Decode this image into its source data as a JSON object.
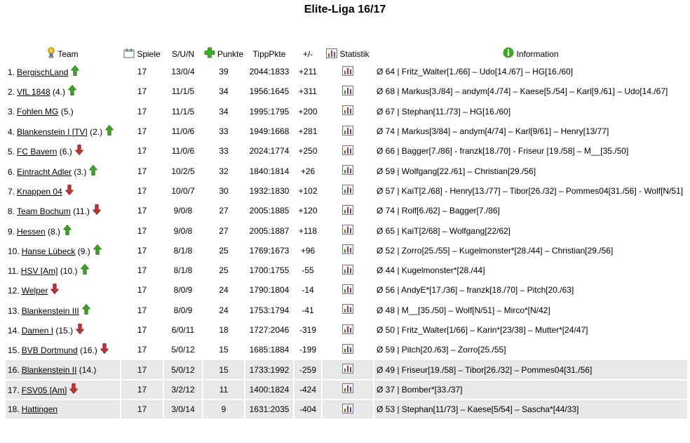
{
  "title": "Elite-Liga 16/17",
  "headers": {
    "team": "Team",
    "spiele": "Spiele",
    "sun": "S/U/N",
    "punkte": "Punkte",
    "tipppkte": "TippPkte",
    "diff": "+/-",
    "statistik": "Statistik",
    "information": "Information"
  },
  "colors": {
    "up": "#3aa820",
    "down": "#c03030",
    "shaded_row": "#e8e8e8",
    "info_icon": "#3aa820"
  },
  "rows": [
    {
      "pos": "1.",
      "team": "BergischLand",
      "prev": "",
      "trend": "up",
      "spiele": "17",
      "sun": "13/0/4",
      "punkte": "39",
      "tipp": "2044:1833",
      "diff": "+211",
      "info": "Ø 64 | Fritz_Walter[1./66] – Udo[14./67] – HG[16./60]",
      "shaded": false
    },
    {
      "pos": "2.",
      "team": "VfL 1848",
      "prev": "(4.)",
      "trend": "up",
      "spiele": "17",
      "sun": "11/1/5",
      "punkte": "34",
      "tipp": "1956:1645",
      "diff": "+311",
      "info": "Ø 68 | Markus[3./84] – andym[4./74] – Kaese[5./54] – Karl[9./61] – Udo[14./67]",
      "shaded": false
    },
    {
      "pos": "3.",
      "team": "Fohlen MG",
      "prev": "(5.)",
      "trend": "",
      "spiele": "17",
      "sun": "11/1/5",
      "punkte": "34",
      "tipp": "1995:1795",
      "diff": "+200",
      "info": "Ø 67 | Stephan[11./73] – HG[16./60]",
      "shaded": false
    },
    {
      "pos": "4.",
      "team": "Blankenstein I [TV]",
      "prev": "(2.)",
      "trend": "up",
      "spiele": "17",
      "sun": "11/0/6",
      "punkte": "33",
      "tipp": "1949:1668",
      "diff": "+281",
      "info": "Ø 74 | Markus[3/84] – andym[4/74] – Karl[9/61] – Henry[13/77]",
      "shaded": false
    },
    {
      "pos": "5.",
      "team": "FC Bavern",
      "prev": "(6.)",
      "trend": "down",
      "spiele": "17",
      "sun": "11/0/6",
      "punkte": "33",
      "tipp": "2024:1774",
      "diff": "+250",
      "info": "Ø 66 | Bagger[7./86] - franzk[18./70] - Friseur [19./58] – M__[35./50]",
      "shaded": false
    },
    {
      "pos": "6.",
      "team": "Eintracht Adler",
      "prev": "(3.)",
      "trend": "up",
      "spiele": "17",
      "sun": "10/2/5",
      "punkte": "32",
      "tipp": "1840:1814",
      "diff": "+26",
      "info": "Ø 59 | Wolfgang[22./61] – Christian[29./56]",
      "shaded": false
    },
    {
      "pos": "7.",
      "team": "Knappen 04",
      "prev": "",
      "trend": "down",
      "spiele": "17",
      "sun": "10/0/7",
      "punkte": "30",
      "tipp": "1932:1830",
      "diff": "+102",
      "info": "Ø 57 | KaiT[2./68] - Henry[13./77] – Tibor[26./32] – Pommes04[31./56] - Wolf[N/51]",
      "shaded": false
    },
    {
      "pos": "8.",
      "team": "Team Bochum",
      "prev": "(11.)",
      "trend": "down",
      "spiele": "17",
      "sun": "9/0/8",
      "punkte": "27",
      "tipp": "2005:1885",
      "diff": "+120",
      "info": "Ø 74 | Rolf[6./62] – Bagger[7./86]",
      "shaded": false
    },
    {
      "pos": "9.",
      "team": "Hessen",
      "prev": "(8.)",
      "trend": "up",
      "spiele": "17",
      "sun": "9/0/8",
      "punkte": "27",
      "tipp": "2005:1887",
      "diff": "+118",
      "info": "Ø 65 | KaiT[2/68] – Wolfgang[22/62]",
      "shaded": false
    },
    {
      "pos": "10.",
      "team": "Hanse Lübeck",
      "prev": "(9.)",
      "trend": "up",
      "spiele": "17",
      "sun": "8/1/8",
      "punkte": "25",
      "tipp": "1769:1673",
      "diff": "+96",
      "info": "Ø 52 | Zorro[25./55] – Kugelmonster*[28./44] – Christian[29./56]",
      "shaded": false
    },
    {
      "pos": "11.",
      "team": "HSV [Am]",
      "prev": "(10.)",
      "trend": "up",
      "spiele": "17",
      "sun": "8/1/8",
      "punkte": "25",
      "tipp": "1700:1755",
      "diff": "-55",
      "info": "Ø 44 | Kugelmonster*[28./44]",
      "shaded": false
    },
    {
      "pos": "12.",
      "team": "Welper",
      "prev": "",
      "trend": "down",
      "spiele": "17",
      "sun": "8/0/9",
      "punkte": "24",
      "tipp": "1790:1804",
      "diff": "-14",
      "info": "Ø 56 | AndyE*[17./36] – franzk[18./70] – Pitch[20./63]",
      "shaded": false
    },
    {
      "pos": "13.",
      "team": "Blankenstein III",
      "prev": "",
      "trend": "up",
      "spiele": "17",
      "sun": "8/0/9",
      "punkte": "24",
      "tipp": "1753:1794",
      "diff": "-41",
      "info": "Ø 48 | M__[35./50] – Wolf[N/51] – Mirco*[N/42]",
      "shaded": false
    },
    {
      "pos": "14.",
      "team": "Damen I",
      "prev": "(15.)",
      "trend": "down",
      "spiele": "17",
      "sun": "6/0/11",
      "punkte": "18",
      "tipp": "1727:2046",
      "diff": "-319",
      "info": "Ø 50 | Fritz_Walter[1/66] – Karin*[23/38] – Mutter*[24/47]",
      "shaded": false
    },
    {
      "pos": "15.",
      "team": "BVB Dortmund",
      "prev": "(16.)",
      "trend": "down",
      "spiele": "17",
      "sun": "5/0/12",
      "punkte": "15",
      "tipp": "1685:1884",
      "diff": "-199",
      "info": "Ø 59 | Pitch[20./63] – Zorro[25./55]",
      "shaded": false
    },
    {
      "pos": "16.",
      "team": "Blankenstein II",
      "prev": "(14.)",
      "trend": "",
      "spiele": "17",
      "sun": "5/0/12",
      "punkte": "15",
      "tipp": "1733:1992",
      "diff": "-259",
      "info": "Ø 49 | Friseur[19./58] – Tibor[26./32] – Pommes04[31./56]",
      "shaded": true
    },
    {
      "pos": "17.",
      "team": "FSV05 [Am]",
      "prev": "",
      "trend": "down",
      "spiele": "17",
      "sun": "3/2/12",
      "punkte": "11",
      "tipp": "1400:1824",
      "diff": "-424",
      "info": "Ø 37 | Bomber*[33./37]",
      "shaded": true
    },
    {
      "pos": "18.",
      "team": "Hattingen",
      "prev": "",
      "trend": "",
      "spiele": "17",
      "sun": "3/0/14",
      "punkte": "9",
      "tipp": "1631:2035",
      "diff": "-404",
      "info": "Ø 53 | Stephan[11/73] – Kaese[5/54] – Sascha*[44/33]",
      "shaded": true
    }
  ]
}
